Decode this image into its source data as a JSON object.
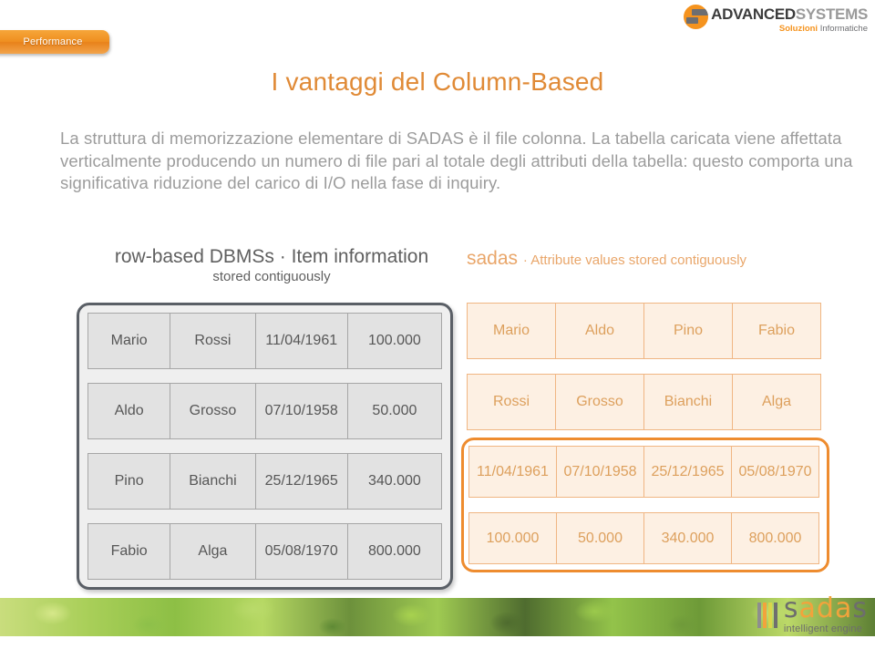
{
  "topbar": {
    "tab_label": "Performance",
    "logo": {
      "name_bold": "ADVANCED",
      "name_light": "SYSTEMS",
      "tagline_accent": "Soluzioni",
      "tagline_rest": "Informatiche",
      "mark_icon": "advanced-systems-circle-icon"
    }
  },
  "slide": {
    "title": "I vantaggi del Column-Based",
    "body": "La struttura di memorizzazione elementare di SADAS è il file colonna. La tabella caricata viene affettata verticalmente producendo un numero di file pari al totale degli attributi della tabella: questo comporta una significativa riduzione del carico di I/O nella fase di inquiry."
  },
  "diagram": {
    "left_heading_line1": "row-based DBMSs · Item information",
    "left_heading_line2": "stored contiguously",
    "right_heading_brand": "sadas",
    "right_heading_rest": "· Attribute values stored contiguously",
    "row_based_rows": [
      [
        "Mario",
        "Rossi",
        "11/04/1961",
        "100.000"
      ],
      [
        "Aldo",
        "Grosso",
        "07/10/1958",
        "50.000"
      ],
      [
        "Pino",
        "Bianchi",
        "25/12/1965",
        "340.000"
      ],
      [
        "Fabio",
        "Alga",
        "05/08/1970",
        "800.000"
      ]
    ],
    "column_based_rows": [
      [
        "Mario",
        "Aldo",
        "Pino",
        "Fabio"
      ],
      [
        "Rossi",
        "Grosso",
        "Bianchi",
        "Alga"
      ],
      [
        "11/04/1961",
        "07/10/1958",
        "25/12/1965",
        "05/08/1970"
      ],
      [
        "100.000",
        "50.000",
        "340.000",
        "800.000"
      ]
    ]
  },
  "footer": {
    "logo_word_part1": "s",
    "logo_word_accent": "ada",
    "logo_word_part2": "s",
    "logo_tagline": "intelligent engine",
    "foliage_icon": "foliage-band-image"
  },
  "colors": {
    "accent_orange": "#e08a36",
    "title_orange": "#e08a36",
    "body_grey": "#9c9c9c",
    "panel_border_dark": "#5a5f66",
    "panel_border_orange": "#ee8c2f",
    "cell_grey_fill": "#e2e2e2",
    "cell_orange_fill": "#fdf0e3"
  }
}
